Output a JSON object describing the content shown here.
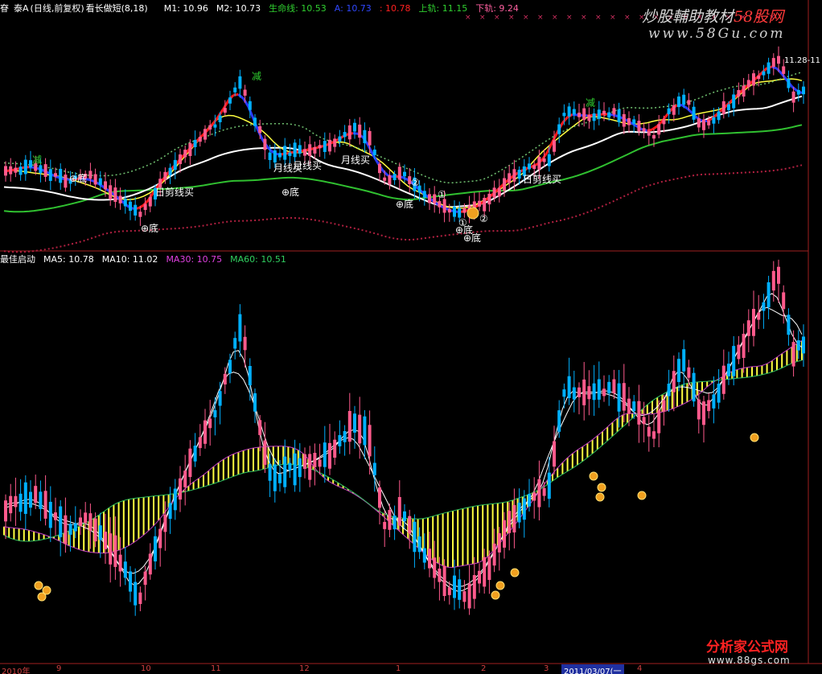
{
  "header_main": {
    "stock_code": "眘",
    "stock_name": "泰A",
    "period": "(日线,前复权)",
    "indicator": "看长做短(8,18)",
    "m1": "M1: 10.96",
    "m2": "M2: 10.73",
    "life_line": "生命线: 10.53",
    "a_value": "A: 10.73",
    "b_value": ": 10.78",
    "upper_rail": "上轨: 11.15",
    "lower_rail": "下轨: 9.24"
  },
  "header_sub": {
    "indicator": "最佳启动",
    "ma5": "MA5: 10.78",
    "ma10": "MA10: 11.02",
    "ma30": "MA30: 10.75",
    "ma60": "MA60: 10.51"
  },
  "watermark": {
    "top_text_1": "炒股輔助教材",
    "top_text_2": "58股网",
    "top_url": "www.58Gu.com",
    "bottom_text": "分析家公式网",
    "bottom_url": "www.88gs.com"
  },
  "x_axis": {
    "labels": [
      "2010年",
      "9",
      "10",
      "11",
      "12",
      "1",
      "2",
      "3",
      "4"
    ],
    "highlight_date": "2011/03/07(一"
  },
  "right_price_label": "11.28-11",
  "signal_labels": {
    "di": "底",
    "jian": "减",
    "yuexian": "月线买",
    "rijian": "日剪线买",
    "circle1": "①",
    "circle2": "②"
  },
  "colors": {
    "up": "#ff4060",
    "up_fill": "#ff5a8c",
    "down": "#00b0ff",
    "red_line": "#ff1a1a",
    "blue_line": "#2a3aff",
    "yellow_line": "#ffff40",
    "white_line": "#ffffff",
    "green_line": "#30c030",
    "dotted_red": "#b02040",
    "band": "#ffff40",
    "ma30_sub": "#c040c0",
    "ma60_sub": "#30c060"
  },
  "chart_data": {
    "type": "candlestick",
    "panels": [
      "price",
      "indicator"
    ],
    "x_axis_months": [
      "2010年",
      "9",
      "10",
      "11",
      "12",
      "1",
      "2",
      "3",
      "4"
    ],
    "price_panel": {
      "series": [
        {
          "name": "M1",
          "last": 10.96
        },
        {
          "name": "M2",
          "last": 10.73
        },
        {
          "name": "生命线",
          "last": 10.53
        },
        {
          "name": "A",
          "last": 10.73
        },
        {
          "name": "上轨",
          "last": 11.15
        },
        {
          "name": "下轨",
          "last": 9.24
        }
      ]
    },
    "indicator_panel": {
      "series": [
        {
          "name": "MA5",
          "last": 10.78
        },
        {
          "name": "MA10",
          "last": 11.02
        },
        {
          "name": "MA30",
          "last": 10.75
        },
        {
          "name": "MA60",
          "last": 10.51
        }
      ]
    }
  }
}
